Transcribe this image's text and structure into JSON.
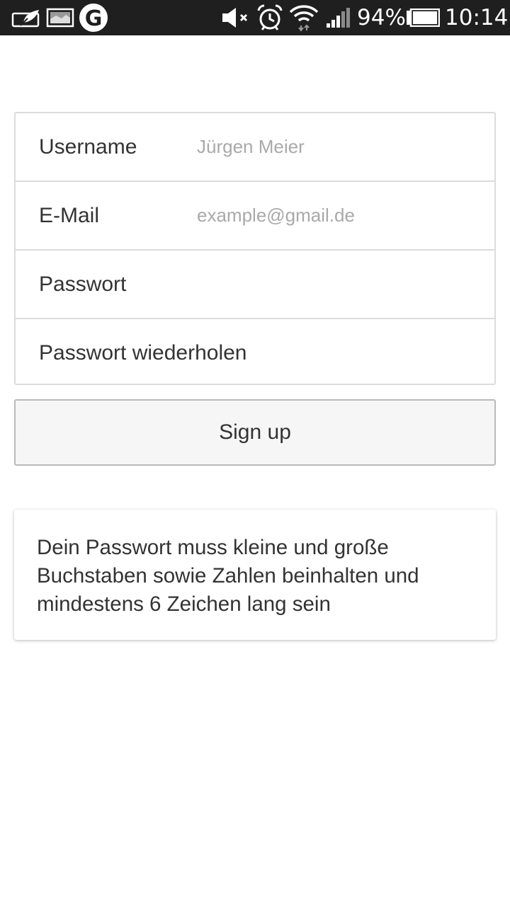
{
  "status_bar": {
    "left_icons": [
      "leaf-notification-icon",
      "image-notification-icon",
      "google-icon"
    ],
    "right_icons": [
      "mute-icon",
      "alarm-icon",
      "wifi-icon",
      "signal-icon",
      "battery-icon"
    ],
    "battery_percent": "94%",
    "time": "10:14",
    "google_label": "G"
  },
  "form": {
    "rows": [
      {
        "label": "Username",
        "placeholder": "Jürgen Meier",
        "type": "text"
      },
      {
        "label": "E-Mail",
        "placeholder": "example@gmail.de",
        "type": "email"
      },
      {
        "label": "Passwort",
        "placeholder": "",
        "type": "password"
      },
      {
        "label": "Passwort wiederholen",
        "placeholder": "",
        "type": "password"
      }
    ]
  },
  "signup_button": {
    "label": "Sign up"
  },
  "info": {
    "text": "Dein Passwort muss kleine und große Buchstaben sowie Zahlen beinhalten und mindestens 6 Zeichen lang sein"
  },
  "colors": {
    "status_bar_bg": "#1f1f1f",
    "border": "#dcdcdc",
    "text": "#333333",
    "placeholder": "#a9a9a9",
    "button_bg": "#f6f6f6"
  }
}
